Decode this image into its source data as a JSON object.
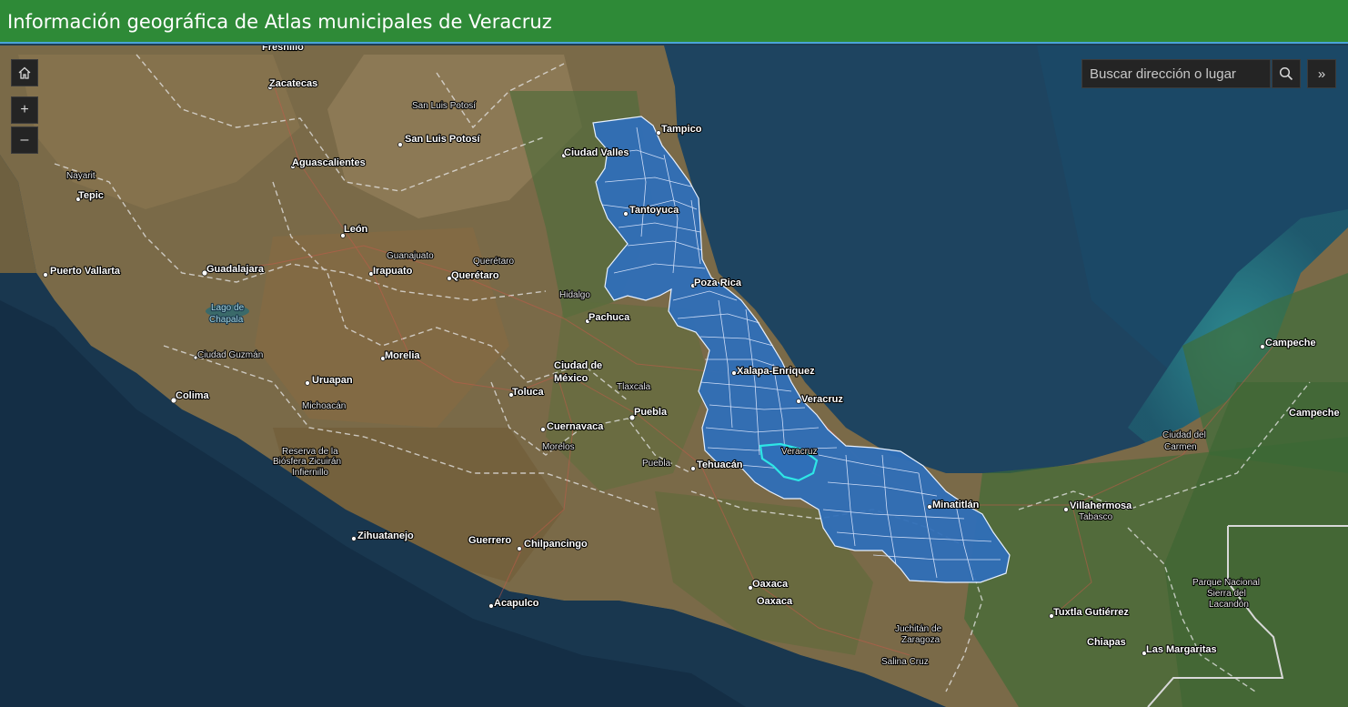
{
  "header": {
    "title": "Información geográfica de Atlas municipales de Veracruz"
  },
  "search": {
    "placeholder": "Buscar dirección o lugar"
  },
  "controls": {
    "home_icon": "home-icon",
    "zoom_in_symbol": "+",
    "zoom_out_symbol": "–",
    "search_icon": "search-icon",
    "expand_symbol": "»"
  },
  "colors": {
    "header": "#2e8a37",
    "veracruz_fill": "#2f6fb8",
    "selected_municipality": "#2ee6e6",
    "ocean": "#1d3d55"
  },
  "map_labels": {
    "fresnillo": "Fresnillo",
    "zacatecas": "Zacatecas",
    "slp_state": "San Luis Potosí",
    "slp_city": "San Luis Potosí",
    "aguascalientes": "Aguascalientes",
    "nayarit": "Nayarit",
    "tepic": "Tepic",
    "leon": "León",
    "guanajuato": "Guanajuato",
    "queretaro_state": "Querétaro",
    "irapuato": "Irapuato",
    "queretaro_city": "Querétaro",
    "puerto_vallarta": "Puerto Vallarta",
    "guadalajara": "Guadalajara",
    "lago_1": "Lago de",
    "lago_2": "Chapala",
    "hidalgo": "Hidalgo",
    "pachuca": "Pachuca",
    "ciudad_guzman": "Ciudad Guzmán",
    "morelia": "Morelia",
    "cdmx_1": "Ciudad de",
    "cdmx_2": "México",
    "uruapan": "Uruapan",
    "toluca": "Toluca",
    "tlaxcala": "Tlaxcala",
    "colima": "Colima",
    "michoacan": "Michoacán",
    "puebla_city": "Puebla",
    "cuernavaca": "Cuernavaca",
    "morelos": "Morelos",
    "reserva_1": "Reserva de la",
    "reserva_2": "Biósfera Zicuirán",
    "reserva_3": "Infiernillo",
    "puebla_state": "Puebla",
    "tehuacan": "Tehuacán",
    "zihuatanejo": "Zihuatanejo",
    "guerrero": "Guerrero",
    "chilpancingo": "Chilpancingo",
    "acapulco": "Acapulco",
    "oaxaca_city": "Oaxaca",
    "oaxaca_state": "Oaxaca",
    "juchitan_1": "Juchitán de",
    "juchitan_2": "Zaragoza",
    "salina_cruz": "Salina Cruz",
    "tampico": "Tampico",
    "ciudad_valles": "Ciudad Valles",
    "tantoyuca": "Tantoyuca",
    "poza_rica": "Poza Rica",
    "xalapa": "Xalapa-Enriquez",
    "veracruz_city": "Veracruz",
    "veracruz_state": "Veracruz",
    "minatitlan": "Minatitlán",
    "villahermosa": "Villahermosa",
    "tabasco": "Tabasco",
    "cdcarmen_1": "Ciudad del",
    "cdcarmen_2": "Carmen",
    "campeche_city": "Campeche",
    "campeche_state": "Campeche",
    "tuxtla": "Tuxtla Gutiérrez",
    "chiapas": "Chiapas",
    "las_margaritas": "Las Margaritas",
    "lacandon_1": "Parque Nacional",
    "lacandon_2": "Sierra del",
    "lacandon_3": "Lacandón"
  }
}
